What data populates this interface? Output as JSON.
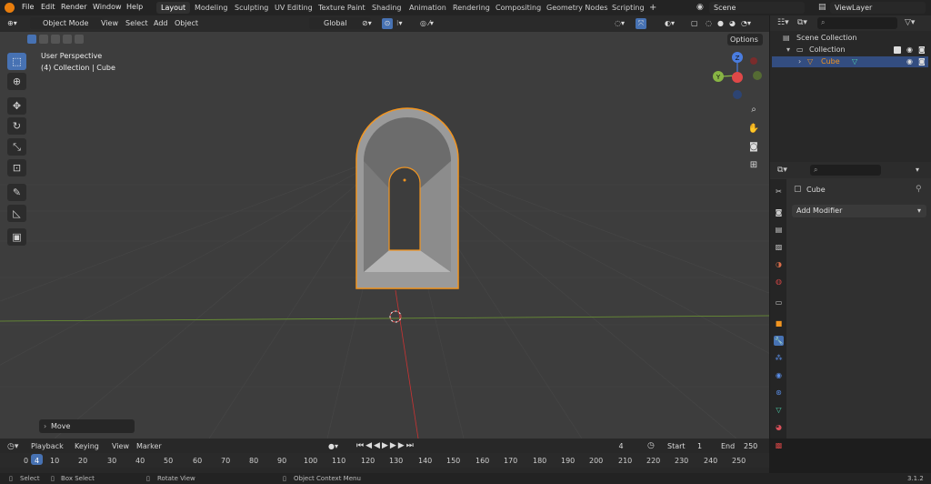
{
  "menu": [
    "File",
    "Edit",
    "Render",
    "Window",
    "Help"
  ],
  "workspaces": [
    "Layout",
    "Modeling",
    "Sculpting",
    "UV Editing",
    "Texture Paint",
    "Shading",
    "Animation",
    "Rendering",
    "Compositing",
    "Geometry Nodes",
    "Scripting"
  ],
  "workspace_add": "+",
  "scene_field": "Scene",
  "viewlayer_field": "ViewLayer",
  "viewport_header": {
    "mode": "Object Mode",
    "menus": [
      "View",
      "Select",
      "Add",
      "Object"
    ],
    "transform": "Global",
    "options": "Options"
  },
  "overlay_text": {
    "perspective": "User Perspective",
    "collection": "(4) Collection | Cube"
  },
  "gizmo": {
    "z": "Z",
    "y": "Y"
  },
  "last_operator": "Move",
  "outliner": {
    "scene_collection": "Scene Collection",
    "collection": "Collection",
    "object": "Cube"
  },
  "properties": {
    "object_name": "Cube",
    "add_modifier": "Add Modifier"
  },
  "timeline": {
    "menus": [
      "Playback",
      "Keying",
      "View",
      "Marker"
    ],
    "current_frame": "4",
    "start_label": "Start",
    "start": "1",
    "end_label": "End",
    "end": "250",
    "ruler": [
      "0",
      "4",
      "10",
      "20",
      "30",
      "40",
      "50",
      "60",
      "70",
      "80",
      "90",
      "100",
      "110",
      "120",
      "130",
      "140",
      "150",
      "160",
      "170",
      "180",
      "190",
      "200",
      "210",
      "220",
      "230",
      "240",
      "250"
    ]
  },
  "statusbar": {
    "select": "Select",
    "box_select": "Box Select",
    "rotate_view": "Rotate View",
    "context_menu": "Object Context Menu",
    "version": "3.1.2"
  },
  "colors": {
    "accent": "#4772b3",
    "selection_outline": "#f29520",
    "x_axis": "#e04848",
    "y_axis": "#88b544",
    "z_axis": "#4a7de0"
  }
}
